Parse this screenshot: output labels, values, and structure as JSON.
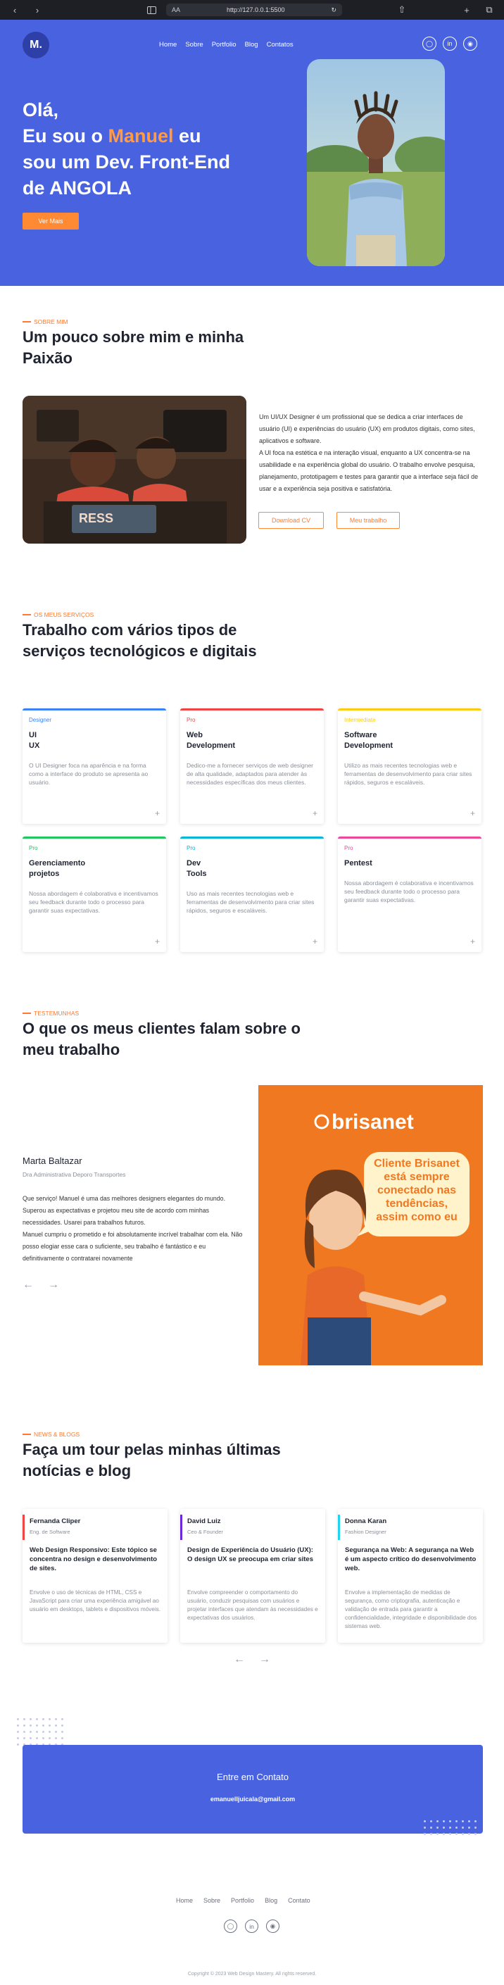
{
  "browser": {
    "reader_label": "AA",
    "url": "http://127.0.0.1:5500",
    "icons": [
      "back-icon",
      "forward-icon",
      "sidebar-icon",
      "reload-icon",
      "share-icon",
      "new-tab-icon",
      "tabs-icon"
    ]
  },
  "header": {
    "logo": "M.",
    "nav": [
      "Home",
      "Sobre",
      "Portfolio",
      "Blog",
      "Contatos"
    ],
    "social_icons": [
      "instagram-icon",
      "linkedin-icon",
      "github-icon"
    ]
  },
  "hero": {
    "line1": "Olá,",
    "line2_prefix": "Eu sou o ",
    "name": "Manuel",
    "line2_suffix": " eu",
    "line3": "sou um Dev. Front-End",
    "line4": "de ANGOLA",
    "cta": "Ver Mais"
  },
  "about": {
    "kicker": "SOBRE MIM",
    "title": "Um pouco sobre mim e minha Paixão",
    "paragraph1": "Um UI/UX Designer é um profissional que se dedica a criar interfaces de usuário (UI) e experiências do usuário (UX) em produtos digitais, como sites, aplicativos e software.",
    "paragraph2": "A UI foca na estética e na interação visual, enquanto a UX concentra-se na usabilidade e na experiência global do usuário. O trabalho envolve pesquisa, planejamento, prototipagem e testes para garantir que a interface seja fácil de usar e a experiência seja positiva e satisfatória.",
    "download_cv": "Download CV",
    "my_work": "Meu trabalho"
  },
  "services": {
    "kicker": "OS MEUS SERVIÇOS",
    "title": "Trabalho com vários tipos de serviços tecnológicos e digitais",
    "items": [
      {
        "tag": "Designer",
        "name": "UI\nUX",
        "desc": "O UI Designer foca na aparência e na forma como a interface do produto se apresenta ao usuário.",
        "color": "#3b82f6"
      },
      {
        "tag": "Pro",
        "name": "Web\nDevelopment",
        "desc": "Dedico-me a fornecer serviços de web designer de alta qualidade, adaptados para atender às necessidades específicas dos meus clientes.",
        "color": "#ef4444"
      },
      {
        "tag": "Intermediate",
        "name": "Software\nDevelopment",
        "desc": "Utilizo as mais recentes tecnologias web e ferramentas de desenvolvimento para criar sites rápidos, seguros e escaláveis.",
        "color": "#facc15"
      },
      {
        "tag": "Pro",
        "name": "Gerenciamento\nprojetos",
        "desc": "Nossa abordagem é colaborativa e incentivamos seu feedback durante todo o processo para garantir suas expectativas.",
        "color": "#22c55e"
      },
      {
        "tag": "Pro",
        "name": "Dev\nTools",
        "desc": "Uso as mais recentes tecnologias web e ferramentas de desenvolvimento para criar sites rápidos, seguros e escaláveis.",
        "color": "#06b6d4"
      },
      {
        "tag": "Pro",
        "name": "Pentest",
        "desc": "Nossa abordagem é colaborativa e incentivamos seu feedback durante todo o processo para garantir suas expectativas.",
        "color": "#ec4899"
      }
    ]
  },
  "testimonials": {
    "kicker": "TESTEMUNHAS",
    "title": "O que os meus clientes falam sobre o meu trabalho",
    "name": "Marta Baltazar",
    "role": "Dra Administrativa Deporo Transportes",
    "quote1": "Que serviço! Manuel é uma das melhores designers elegantes do mundo. Superou as expectativas e projetou meu site de acordo com minhas necessidades. Usarei para trabalhos futuros.",
    "quote2": "Manuel cumpriu o prometido e foi absolutamente incrível trabalhar com ela. Não posso elogiar esse cara o suficiente, seu trabalho é fantástico e eu definitivamente o contratarei novamente",
    "brand": "brisanet",
    "bubble": "Cliente Brisanet está sempre conectado nas tendências, assim como eu"
  },
  "blog": {
    "kicker": "NEWS & BLOGS",
    "title": "Faça um tour pelas minhas últimas notícias e blog",
    "posts": [
      {
        "author": "Fernanda Cliper",
        "role": "Eng. de Software",
        "title": "Web Design Responsivo: Este tópico se concentra no design e desenvolvimento de sites.",
        "desc": "Envolve o uso de técnicas de HTML, CSS e JavaScript para criar uma experiência amigável ao usuário em desktops, tablets e dispositivos móveis.",
        "color": "#ef4444"
      },
      {
        "author": "David Luiz",
        "role": "Ceo & Founder",
        "title": "Design de Experiência do Usuário (UX): O design UX se preocupa em criar sites",
        "desc": "Envolve compreender o comportamento do usuário, conduzir pesquisas com usuários e projetar interfaces que atendam às necessidades e expectativas dos usuários.",
        "color": "#6d28d9"
      },
      {
        "author": "Donna Karan",
        "role": "Fashion Designer",
        "title": "Segurança na Web: A segurança na Web é um aspecto crítico do desenvolvimento web.",
        "desc": "Envolve a implementação de medidas de segurança, como criptografia, autenticação e validação de entrada para garantir a confidencialidade, integridade e disponibilidade dos sistemas web.",
        "color": "#22d3ee"
      }
    ]
  },
  "contact": {
    "title": "Entre em Contato",
    "email": "emanuelljuicala@gmail.com"
  },
  "footer": {
    "nav": [
      "Home",
      "Sobre",
      "Portfolio",
      "Blog",
      "Contato"
    ],
    "social_icons": [
      "instagram-icon",
      "linkedin-icon",
      "github-icon"
    ],
    "copyright": "Copyright © 2023 Web Design Mastery. All rights reserved."
  },
  "colors": {
    "primary": "#4862e0",
    "accent": "#ff8a33"
  }
}
